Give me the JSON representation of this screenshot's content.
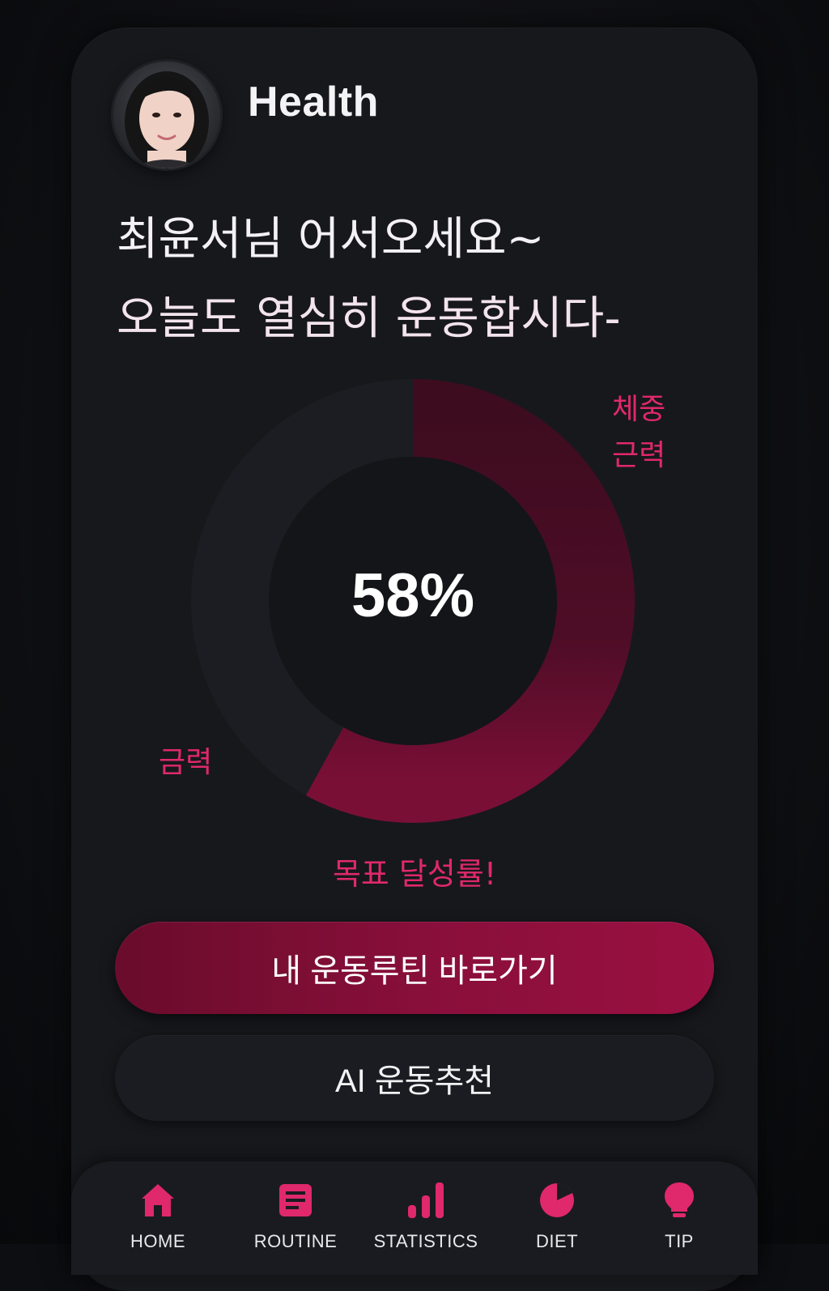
{
  "header": {
    "app_title": "Health",
    "avatar_alt": "profile photo"
  },
  "greeting": {
    "line1": "최윤서님 어서오세요~",
    "line2": "오늘도 열심히 운동합시다-"
  },
  "progress": {
    "percent_label": "58%",
    "percent_value": 58,
    "labels": {
      "weight": "체중",
      "muscle": "근력",
      "strength": "금력"
    },
    "goal_label": "목표 달성률!"
  },
  "actions": {
    "primary_label": "내 운동루틴 바로가기",
    "secondary_label": "AI 운동추천"
  },
  "nav": {
    "items": [
      {
        "label": "HOME",
        "icon": "home-icon"
      },
      {
        "label": "ROUTINE",
        "icon": "document-icon"
      },
      {
        "label": "STATISTICS",
        "icon": "bar-chart-icon"
      },
      {
        "label": "DIET",
        "icon": "pie-icon"
      },
      {
        "label": "TIP",
        "icon": "lightbulb-icon"
      }
    ]
  },
  "colors": {
    "accent": "#e0286c",
    "button_primary": "#8a0f3a",
    "ring_filled": "#6b0f2f",
    "ring_empty": "#1e1f24",
    "background": "#17181c"
  }
}
